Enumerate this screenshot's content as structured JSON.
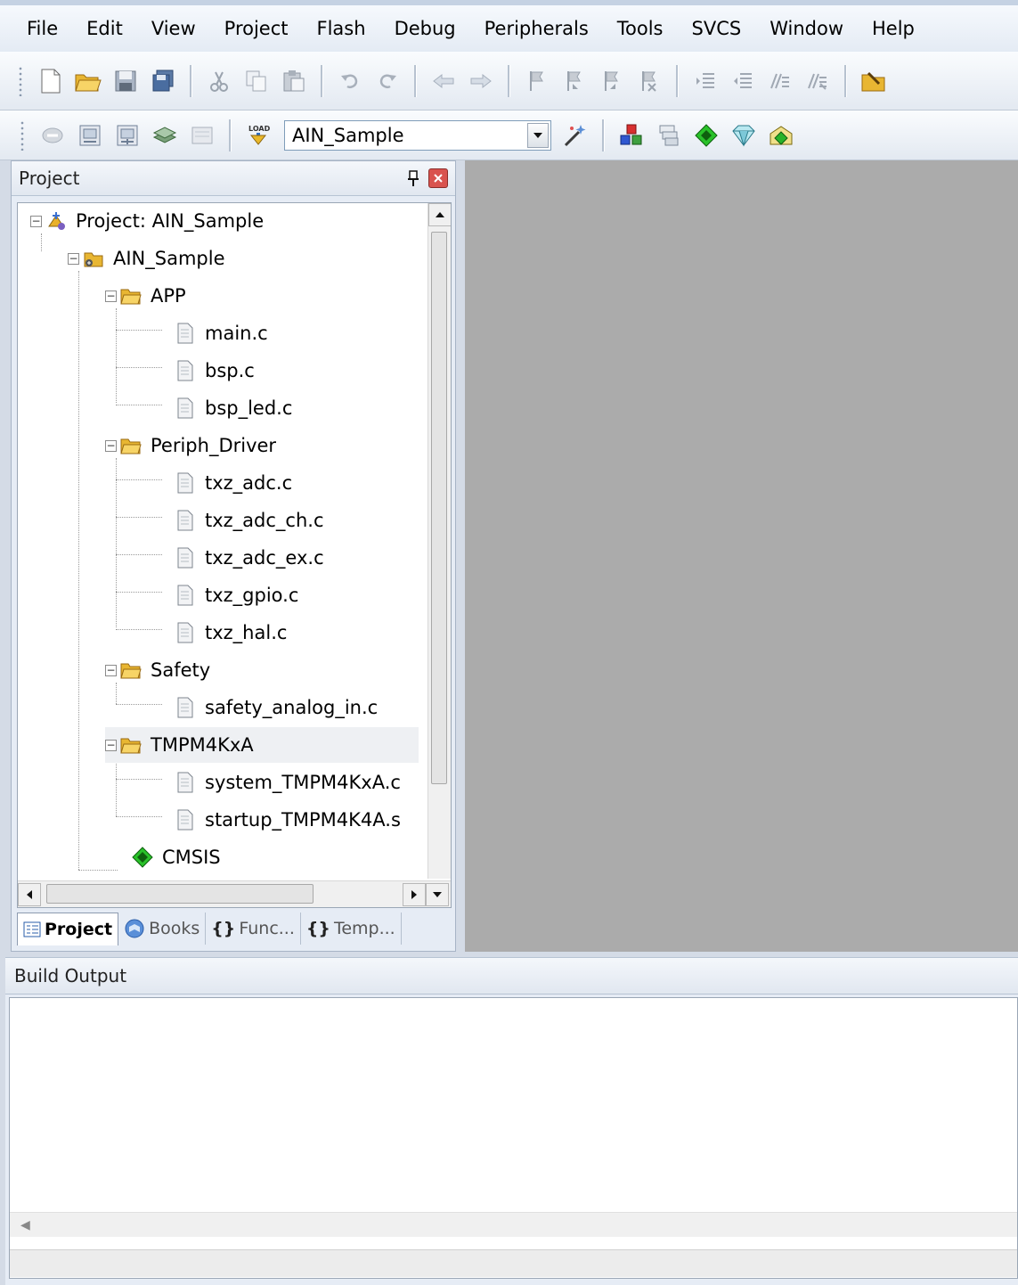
{
  "menu": [
    "File",
    "Edit",
    "View",
    "Project",
    "Flash",
    "Debug",
    "Peripherals",
    "Tools",
    "SVCS",
    "Window",
    "Help"
  ],
  "toolbar2": {
    "target_value": "AIN_Sample"
  },
  "project_panel": {
    "title": "Project",
    "pin_glyph": "📌",
    "close_glyph": "✕",
    "tree": [
      {
        "label": "Project: AIN_Sample",
        "icon": "project-icon"
      },
      {
        "label": "AIN_Sample",
        "icon": "target-folder-icon"
      },
      {
        "label": "APP",
        "icon": "folder-icon"
      },
      {
        "label": "main.c",
        "icon": "file-icon"
      },
      {
        "label": "bsp.c",
        "icon": "file-icon"
      },
      {
        "label": "bsp_led.c",
        "icon": "file-icon"
      },
      {
        "label": "Periph_Driver",
        "icon": "folder-icon"
      },
      {
        "label": "txz_adc.c",
        "icon": "file-icon"
      },
      {
        "label": "txz_adc_ch.c",
        "icon": "file-icon"
      },
      {
        "label": "txz_adc_ex.c",
        "icon": "file-icon"
      },
      {
        "label": "txz_gpio.c",
        "icon": "file-icon"
      },
      {
        "label": "txz_hal.c",
        "icon": "file-icon"
      },
      {
        "label": "Safety",
        "icon": "folder-icon"
      },
      {
        "label": "safety_analog_in.c",
        "icon": "file-icon"
      },
      {
        "label": "TMPM4KxA",
        "icon": "folder-icon"
      },
      {
        "label": "system_TMPM4KxA.c",
        "icon": "file-icon"
      },
      {
        "label": "startup_TMPM4K4A.s",
        "icon": "file-icon"
      },
      {
        "label": "CMSIS",
        "icon": "component-icon"
      }
    ],
    "tabs": [
      {
        "label": "Project",
        "icon": "project-tab-icon",
        "active": true
      },
      {
        "label": "Books",
        "icon": "books-icon",
        "active": false
      },
      {
        "label": "Func...",
        "icon": "functions-icon",
        "active": false
      },
      {
        "label": "Temp...",
        "icon": "templates-icon",
        "active": false
      }
    ],
    "tab_glyphs": {
      "functions": "{}",
      "templates": "{}"
    }
  },
  "build_output": {
    "title": "Build Output",
    "scroll_left_glyph": "◀"
  },
  "colors": {
    "editor_bg": "#ababab",
    "panel_bg": "#e6ecf5",
    "selection": "#eef0f3"
  }
}
